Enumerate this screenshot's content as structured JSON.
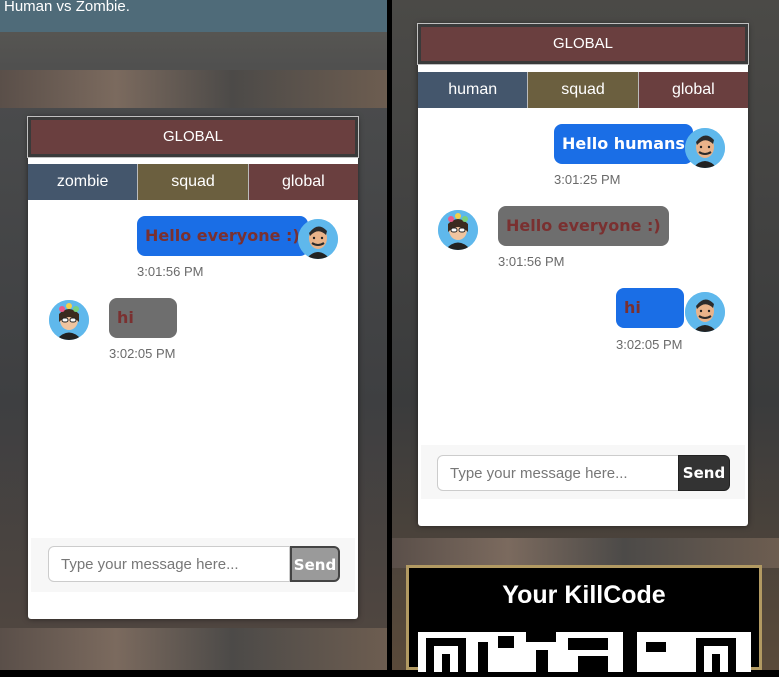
{
  "left": {
    "banner": "Human vs Zombie.",
    "chat": {
      "title": "GLOBAL",
      "tabs": [
        "zombie",
        "squad",
        "global"
      ],
      "messages": [
        {
          "side": "right",
          "text": "Hello everyone :)",
          "time": "3:01:56 PM"
        },
        {
          "side": "left",
          "text": "hi",
          "time": "3:02:05 PM"
        }
      ],
      "input_placeholder": "Type your message here...",
      "send_label": "Send"
    }
  },
  "right": {
    "chat": {
      "title": "GLOBAL",
      "tabs": [
        "human",
        "squad",
        "global"
      ],
      "messages": [
        {
          "side": "right",
          "text": "Hello humans",
          "time": "3:01:25 PM"
        },
        {
          "side": "left",
          "text": "Hello everyone :)",
          "time": "3:01:56 PM"
        },
        {
          "side": "right",
          "text": "hi",
          "time": "3:02:05 PM"
        }
      ],
      "input_placeholder": "Type your message here...",
      "send_label": "Send"
    },
    "killcode_title": "Your KillCode"
  },
  "colors": {
    "tab_blue": "#44566c",
    "tab_olive": "#6b5f3f",
    "tab_red": "#6a3f3f",
    "bubble_blue": "#1a6ee6",
    "bubble_gray": "#6e6e6e",
    "killcode_border": "#b29a62"
  },
  "icons": [
    "male-avatar-icon",
    "female-avatar-icon"
  ]
}
